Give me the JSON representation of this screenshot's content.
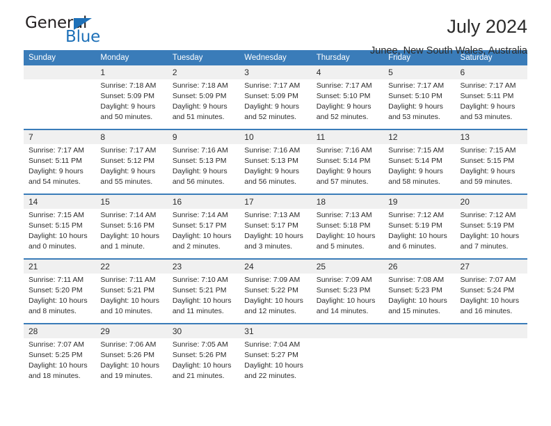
{
  "logo": {
    "word_top": "General",
    "word_bottom": "Blue",
    "triangle_color": "#1d70b8"
  },
  "header": {
    "title": "July 2024",
    "subtitle": "Junee, New South Wales, Australia"
  },
  "theme": {
    "header_bg": "#3a7cb9",
    "daynum_bg": "#f0f0f0",
    "text": "#2b2b2b"
  },
  "weekday_headers": [
    "Sunday",
    "Monday",
    "Tuesday",
    "Wednesday",
    "Thursday",
    "Friday",
    "Saturday"
  ],
  "weeks": [
    {
      "days": [
        {
          "num": "",
          "sunrise": "",
          "sunset": "",
          "daylight_a": "",
          "daylight_b": ""
        },
        {
          "num": "1",
          "sunrise": "Sunrise: 7:18 AM",
          "sunset": "Sunset: 5:09 PM",
          "daylight_a": "Daylight: 9 hours",
          "daylight_b": "and 50 minutes."
        },
        {
          "num": "2",
          "sunrise": "Sunrise: 7:18 AM",
          "sunset": "Sunset: 5:09 PM",
          "daylight_a": "Daylight: 9 hours",
          "daylight_b": "and 51 minutes."
        },
        {
          "num": "3",
          "sunrise": "Sunrise: 7:17 AM",
          "sunset": "Sunset: 5:09 PM",
          "daylight_a": "Daylight: 9 hours",
          "daylight_b": "and 52 minutes."
        },
        {
          "num": "4",
          "sunrise": "Sunrise: 7:17 AM",
          "sunset": "Sunset: 5:10 PM",
          "daylight_a": "Daylight: 9 hours",
          "daylight_b": "and 52 minutes."
        },
        {
          "num": "5",
          "sunrise": "Sunrise: 7:17 AM",
          "sunset": "Sunset: 5:10 PM",
          "daylight_a": "Daylight: 9 hours",
          "daylight_b": "and 53 minutes."
        },
        {
          "num": "6",
          "sunrise": "Sunrise: 7:17 AM",
          "sunset": "Sunset: 5:11 PM",
          "daylight_a": "Daylight: 9 hours",
          "daylight_b": "and 53 minutes."
        }
      ]
    },
    {
      "days": [
        {
          "num": "7",
          "sunrise": "Sunrise: 7:17 AM",
          "sunset": "Sunset: 5:11 PM",
          "daylight_a": "Daylight: 9 hours",
          "daylight_b": "and 54 minutes."
        },
        {
          "num": "8",
          "sunrise": "Sunrise: 7:17 AM",
          "sunset": "Sunset: 5:12 PM",
          "daylight_a": "Daylight: 9 hours",
          "daylight_b": "and 55 minutes."
        },
        {
          "num": "9",
          "sunrise": "Sunrise: 7:16 AM",
          "sunset": "Sunset: 5:13 PM",
          "daylight_a": "Daylight: 9 hours",
          "daylight_b": "and 56 minutes."
        },
        {
          "num": "10",
          "sunrise": "Sunrise: 7:16 AM",
          "sunset": "Sunset: 5:13 PM",
          "daylight_a": "Daylight: 9 hours",
          "daylight_b": "and 56 minutes."
        },
        {
          "num": "11",
          "sunrise": "Sunrise: 7:16 AM",
          "sunset": "Sunset: 5:14 PM",
          "daylight_a": "Daylight: 9 hours",
          "daylight_b": "and 57 minutes."
        },
        {
          "num": "12",
          "sunrise": "Sunrise: 7:15 AM",
          "sunset": "Sunset: 5:14 PM",
          "daylight_a": "Daylight: 9 hours",
          "daylight_b": "and 58 minutes."
        },
        {
          "num": "13",
          "sunrise": "Sunrise: 7:15 AM",
          "sunset": "Sunset: 5:15 PM",
          "daylight_a": "Daylight: 9 hours",
          "daylight_b": "and 59 minutes."
        }
      ]
    },
    {
      "days": [
        {
          "num": "14",
          "sunrise": "Sunrise: 7:15 AM",
          "sunset": "Sunset: 5:15 PM",
          "daylight_a": "Daylight: 10 hours",
          "daylight_b": "and 0 minutes."
        },
        {
          "num": "15",
          "sunrise": "Sunrise: 7:14 AM",
          "sunset": "Sunset: 5:16 PM",
          "daylight_a": "Daylight: 10 hours",
          "daylight_b": "and 1 minute."
        },
        {
          "num": "16",
          "sunrise": "Sunrise: 7:14 AM",
          "sunset": "Sunset: 5:17 PM",
          "daylight_a": "Daylight: 10 hours",
          "daylight_b": "and 2 minutes."
        },
        {
          "num": "17",
          "sunrise": "Sunrise: 7:13 AM",
          "sunset": "Sunset: 5:17 PM",
          "daylight_a": "Daylight: 10 hours",
          "daylight_b": "and 3 minutes."
        },
        {
          "num": "18",
          "sunrise": "Sunrise: 7:13 AM",
          "sunset": "Sunset: 5:18 PM",
          "daylight_a": "Daylight: 10 hours",
          "daylight_b": "and 5 minutes."
        },
        {
          "num": "19",
          "sunrise": "Sunrise: 7:12 AM",
          "sunset": "Sunset: 5:19 PM",
          "daylight_a": "Daylight: 10 hours",
          "daylight_b": "and 6 minutes."
        },
        {
          "num": "20",
          "sunrise": "Sunrise: 7:12 AM",
          "sunset": "Sunset: 5:19 PM",
          "daylight_a": "Daylight: 10 hours",
          "daylight_b": "and 7 minutes."
        }
      ]
    },
    {
      "days": [
        {
          "num": "21",
          "sunrise": "Sunrise: 7:11 AM",
          "sunset": "Sunset: 5:20 PM",
          "daylight_a": "Daylight: 10 hours",
          "daylight_b": "and 8 minutes."
        },
        {
          "num": "22",
          "sunrise": "Sunrise: 7:11 AM",
          "sunset": "Sunset: 5:21 PM",
          "daylight_a": "Daylight: 10 hours",
          "daylight_b": "and 10 minutes."
        },
        {
          "num": "23",
          "sunrise": "Sunrise: 7:10 AM",
          "sunset": "Sunset: 5:21 PM",
          "daylight_a": "Daylight: 10 hours",
          "daylight_b": "and 11 minutes."
        },
        {
          "num": "24",
          "sunrise": "Sunrise: 7:09 AM",
          "sunset": "Sunset: 5:22 PM",
          "daylight_a": "Daylight: 10 hours",
          "daylight_b": "and 12 minutes."
        },
        {
          "num": "25",
          "sunrise": "Sunrise: 7:09 AM",
          "sunset": "Sunset: 5:23 PM",
          "daylight_a": "Daylight: 10 hours",
          "daylight_b": "and 14 minutes."
        },
        {
          "num": "26",
          "sunrise": "Sunrise: 7:08 AM",
          "sunset": "Sunset: 5:23 PM",
          "daylight_a": "Daylight: 10 hours",
          "daylight_b": "and 15 minutes."
        },
        {
          "num": "27",
          "sunrise": "Sunrise: 7:07 AM",
          "sunset": "Sunset: 5:24 PM",
          "daylight_a": "Daylight: 10 hours",
          "daylight_b": "and 16 minutes."
        }
      ]
    },
    {
      "days": [
        {
          "num": "28",
          "sunrise": "Sunrise: 7:07 AM",
          "sunset": "Sunset: 5:25 PM",
          "daylight_a": "Daylight: 10 hours",
          "daylight_b": "and 18 minutes."
        },
        {
          "num": "29",
          "sunrise": "Sunrise: 7:06 AM",
          "sunset": "Sunset: 5:26 PM",
          "daylight_a": "Daylight: 10 hours",
          "daylight_b": "and 19 minutes."
        },
        {
          "num": "30",
          "sunrise": "Sunrise: 7:05 AM",
          "sunset": "Sunset: 5:26 PM",
          "daylight_a": "Daylight: 10 hours",
          "daylight_b": "and 21 minutes."
        },
        {
          "num": "31",
          "sunrise": "Sunrise: 7:04 AM",
          "sunset": "Sunset: 5:27 PM",
          "daylight_a": "Daylight: 10 hours",
          "daylight_b": "and 22 minutes."
        },
        {
          "num": "",
          "sunrise": "",
          "sunset": "",
          "daylight_a": "",
          "daylight_b": ""
        },
        {
          "num": "",
          "sunrise": "",
          "sunset": "",
          "daylight_a": "",
          "daylight_b": ""
        },
        {
          "num": "",
          "sunrise": "",
          "sunset": "",
          "daylight_a": "",
          "daylight_b": ""
        }
      ]
    }
  ]
}
